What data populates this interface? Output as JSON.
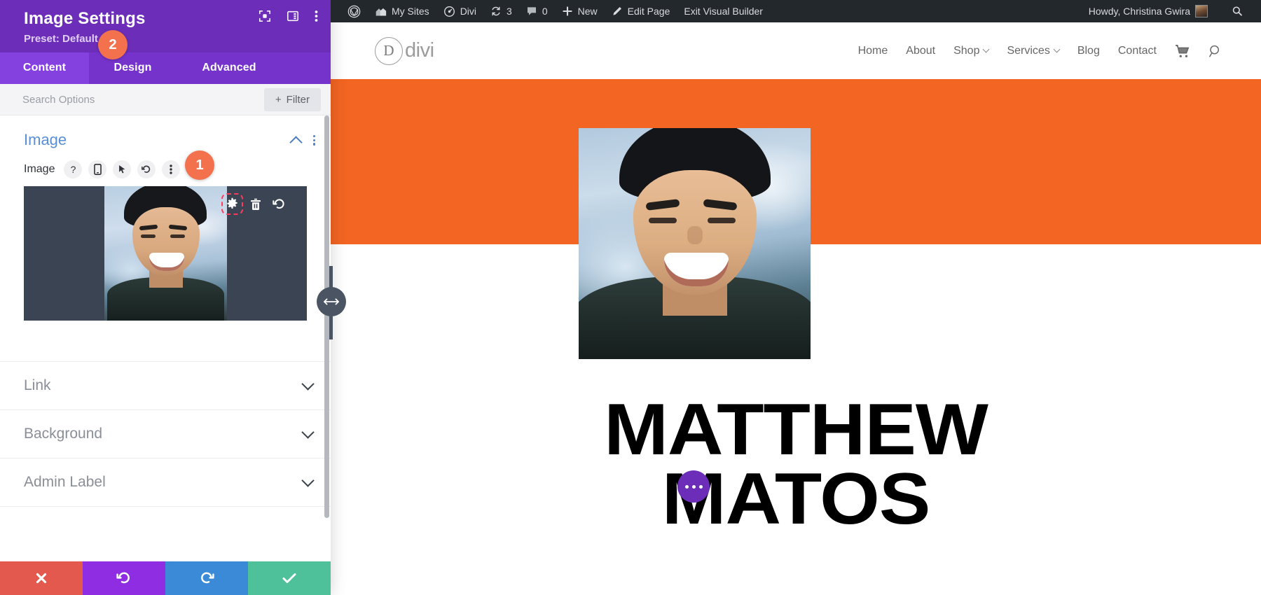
{
  "settings_panel": {
    "title": "Image Settings",
    "preset_label": "Preset: Default",
    "header_icons": [
      {
        "name": "focus-target-icon"
      },
      {
        "name": "layout-panel-icon"
      },
      {
        "name": "kebab-menu-icon"
      }
    ],
    "tabs": [
      {
        "label": "Content",
        "active": true
      },
      {
        "label": "Design",
        "active": false
      },
      {
        "label": "Advanced",
        "active": false
      }
    ],
    "search": {
      "placeholder": "Search Options",
      "value": "",
      "filter_label": "Filter",
      "filter_plus": "+"
    },
    "toggle": {
      "title": "Image",
      "expanded": true
    },
    "image_field": {
      "label": "Image",
      "control_icons": [
        {
          "name": "help-icon",
          "glyph": "?"
        },
        {
          "name": "responsive-phone-icon",
          "glyph": "❑"
        },
        {
          "name": "hover-pointer-icon",
          "glyph": "↖"
        },
        {
          "name": "reset-undo-icon",
          "glyph": "↺"
        },
        {
          "name": "options-kebab-icon",
          "glyph": "⋮"
        }
      ],
      "preview_actions": [
        {
          "name": "settings-gear-icon",
          "selected": true
        },
        {
          "name": "delete-trash-icon",
          "selected": false
        },
        {
          "name": "reset-image-icon",
          "selected": false
        }
      ]
    },
    "accordions": [
      {
        "label": "Link"
      },
      {
        "label": "Background"
      },
      {
        "label": "Admin Label"
      }
    ],
    "footer_actions": [
      {
        "name": "cancel-button",
        "glyph": "✖",
        "color": "#e3594e"
      },
      {
        "name": "undo-button",
        "glyph": "↺",
        "color": "#8e2de2"
      },
      {
        "name": "redo-button",
        "glyph": "↻",
        "color": "#3b8ad8"
      },
      {
        "name": "save-button",
        "glyph": "✔",
        "color": "#4ec19a"
      }
    ],
    "step_badges": [
      {
        "id": "1",
        "label": "1"
      },
      {
        "id": "2",
        "label": "2"
      }
    ]
  },
  "admin_bar": {
    "items": [
      {
        "label": "",
        "icon": "wordpress-logo-icon"
      },
      {
        "label": "My Sites",
        "icon": "sites-house-icon"
      },
      {
        "label": "Divi",
        "icon": "divi-gauge-icon"
      },
      {
        "label": "3",
        "icon": "updates-refresh-icon"
      },
      {
        "label": "0",
        "icon": "comments-bubble-icon"
      },
      {
        "label": "New",
        "icon": "plus-icon"
      },
      {
        "label": "Edit Page",
        "icon": "pencil-edit-icon"
      },
      {
        "label": "Exit Visual Builder",
        "icon": ""
      }
    ],
    "howdy": "Howdy, Christina Gwira",
    "avatar": "user-avatar",
    "search_icon": "search-icon"
  },
  "site_header": {
    "logo_letter": "D",
    "logo_text": "divi",
    "nav": [
      {
        "label": "Home",
        "has_caret": false
      },
      {
        "label": "About",
        "has_caret": false
      },
      {
        "label": "Shop",
        "has_caret": true
      },
      {
        "label": "Services",
        "has_caret": true
      },
      {
        "label": "Blog",
        "has_caret": false
      },
      {
        "label": "Contact",
        "has_caret": false
      }
    ],
    "cart_icon": "shopping-cart-icon",
    "search_icon": "search-icon"
  },
  "page_content": {
    "hero_band_color": "#f26522",
    "hero_image_alt": "portrait-photo",
    "headline_line_1": "MATTHEW",
    "headline_line_2": "MATOS",
    "options_bubble": "module-options-bubble"
  },
  "colors": {
    "panel_purple": "#6c2eb9",
    "tab_purple": "#7633cc",
    "tab_active_purple": "#8541e0",
    "badge_orange": "#f4714e",
    "hero_orange": "#f26522",
    "link_blue": "#5a8fd6",
    "admin_bar_dark": "#23282d"
  }
}
